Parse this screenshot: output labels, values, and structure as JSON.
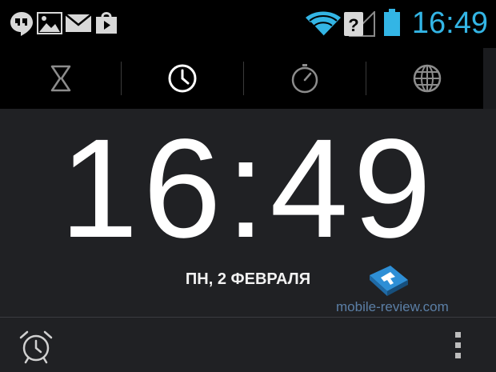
{
  "status_bar": {
    "time": "16:49",
    "accent_color": "#33b5e5",
    "icons": [
      "hangouts-icon",
      "gallery-icon",
      "email-icon",
      "play-store-icon",
      "wifi-icon",
      "no-sim-signal-icon",
      "battery-icon"
    ]
  },
  "tabs": [
    {
      "name": "timer",
      "icon": "hourglass-icon",
      "selected": false
    },
    {
      "name": "clock",
      "icon": "clock-icon",
      "selected": true
    },
    {
      "name": "stopwatch",
      "icon": "stopwatch-icon",
      "selected": false
    },
    {
      "name": "world-clock",
      "icon": "globe-icon",
      "selected": false
    }
  ],
  "clock": {
    "time": "16:49",
    "date": "ПН, 2 ФЕВРАЛЯ"
  },
  "watermark": {
    "text": "mobile-review.com"
  },
  "bottom_bar": {
    "alarm_icon": "alarm-icon",
    "menu_icon": "overflow-menu-icon"
  }
}
